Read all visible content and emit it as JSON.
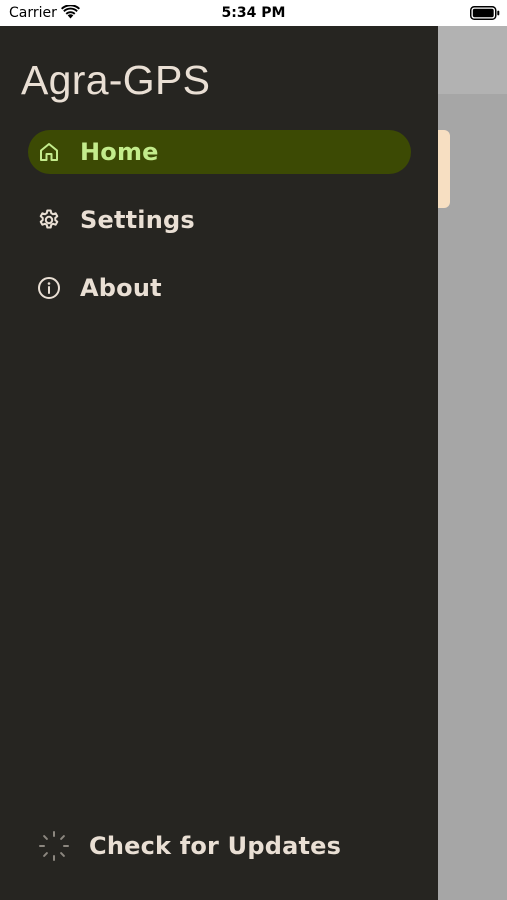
{
  "status_bar": {
    "carrier": "Carrier",
    "time": "5:34 PM"
  },
  "drawer": {
    "title": "Agra-GPS",
    "items": [
      {
        "label": "Home",
        "icon": "home-icon",
        "active": true
      },
      {
        "label": "Settings",
        "icon": "gear-icon",
        "active": false
      },
      {
        "label": "About",
        "icon": "info-icon",
        "active": false
      }
    ],
    "footer": {
      "label": "Check for Updates",
      "icon": "loading-spinner-icon"
    }
  },
  "colors": {
    "drawer_bg": "#262521",
    "active_item_bg": "#3c4a04",
    "active_item_text": "#c3ec8c",
    "text": "#e9dfd4",
    "backdrop": "#a6a6a6"
  }
}
